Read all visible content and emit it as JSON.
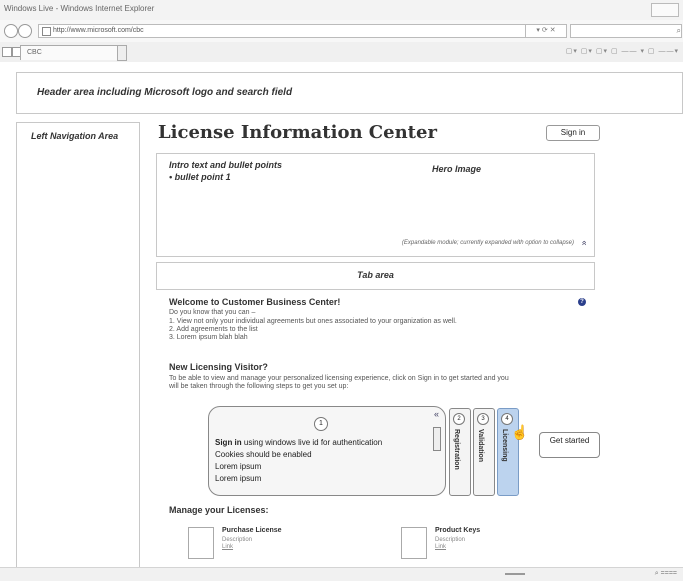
{
  "window": {
    "title": "Windows Live - Windows Internet Explorer"
  },
  "address": {
    "url": "http://www.microsoft.com/cbc",
    "search_icon": "⌕"
  },
  "tabs": [
    {
      "label": "CBC"
    }
  ],
  "header": {
    "text": "Header area including Microsoft logo and search field"
  },
  "left_nav": {
    "text": "Left Navigation Area"
  },
  "main": {
    "title": "License Information Center",
    "sign_in": "Sign in",
    "hero": {
      "intro_line1": "Intro text and bullet points",
      "intro_line2": "• bullet point 1",
      "hero_label": "Hero Image",
      "note": "(Expandable module; currently expanded with option to collapse)",
      "collapse_icon": "»"
    },
    "tab_area": "Tab area",
    "welcome": {
      "title": "Welcome to Customer Business Center!",
      "lead": "Do you know that you can –",
      "items": [
        "1.   View not only your individual agreements but ones associated to your organization as well.",
        "2.   Add agreements to the list",
        "3.   Lorem ipsum blah blah"
      ]
    },
    "visitor": {
      "title": "New Licensing Visitor?",
      "text1": "To be able to view and manage your personalized licensing experience, click on Sign in to get started and you",
      "text2": "will be taken through the following steps to get you set up:"
    },
    "wizard": {
      "step_number": "1",
      "line1_bold": "Sign in",
      "line1_rest": " using windows live id for authentication",
      "line2": "Cookies should be enabled",
      "line3": "Lorem ipsum",
      "line4": "Lorem ipsum",
      "steps": [
        {
          "num": "2",
          "label": "Registration"
        },
        {
          "num": "3",
          "label": "Validation"
        },
        {
          "num": "4",
          "label": "Licensing"
        }
      ],
      "chevron": "«"
    },
    "get_started": "Get started",
    "manage": {
      "title": "Manage your Licenses:",
      "items": [
        {
          "title": "Purchase License",
          "desc": "Description",
          "link": "Link"
        },
        {
          "title": "Product Keys",
          "desc": "Description",
          "link": "Link"
        }
      ]
    }
  },
  "status": {
    "zoom": "⌕ ===="
  }
}
